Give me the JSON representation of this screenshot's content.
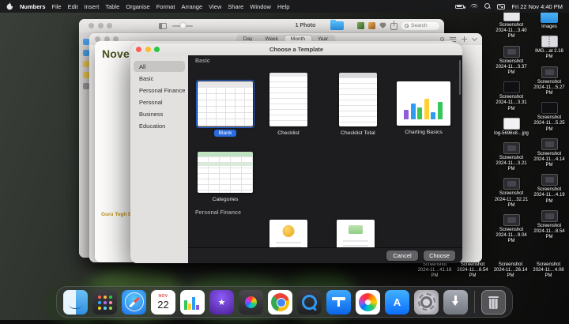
{
  "colors": {
    "accent": "#2a6bdf",
    "traffic_red": "#ff5f57",
    "traffic_yellow": "#febc2e",
    "traffic_green": "#28c840"
  },
  "menu_bar": {
    "app_name": "Numbers",
    "items": [
      "File",
      "Edit",
      "Insert",
      "Table",
      "Organise",
      "Format",
      "Arrange",
      "View",
      "Share",
      "Window",
      "Help"
    ],
    "clock": "Fri 22 Nov 4:40 PM"
  },
  "photos_window": {
    "count_label": "1 Photo",
    "search_placeholder": "Search"
  },
  "calendar_window": {
    "segments": [
      "Day",
      "Week",
      "Month",
      "Year"
    ],
    "selected_segment": "Month",
    "event_label": "Guru Tegh Baha…"
  },
  "numbers_window": {
    "doc_title": "Noven"
  },
  "template_chooser": {
    "title": "Choose a Template",
    "sidebar_items": [
      "All",
      "Basic",
      "Personal Finance",
      "Personal",
      "Business",
      "Education"
    ],
    "selected_category": "All",
    "section_basic": "Basic",
    "section_personal_finance": "Personal Finance",
    "templates": {
      "blank": "Blank",
      "checklist": "Checklist",
      "checklist_total": "Checklist Total",
      "charting_basics": "Charting Basics",
      "categories": "Categories"
    },
    "selected_template": "Blank",
    "buttons": {
      "cancel": "Cancel",
      "choose": "Choose"
    }
  },
  "desktop_icons": {
    "column1": [
      {
        "label": "Screenshot 2024-11…3.40 PM"
      },
      {
        "label": "Screenshot 2024-11…3.37 PM"
      },
      {
        "label": "Screenshot 2024-11…3.31 PM"
      },
      {
        "label": "log-5696x8…jpg"
      },
      {
        "label": "Screenshot 2024-11…3.21 PM"
      },
      {
        "label": "Screenshot 2024-11…32.21 PM"
      },
      {
        "label": "Screenshot 2024-11…9.04 PM"
      }
    ],
    "column2": [
      {
        "label": "Images"
      },
      {
        "label": "IMG…at 2.18 PM"
      },
      {
        "label": "Screenshot 2024-11…5.27 PM"
      },
      {
        "label": "Screenshot 2024-11…5.25 PM"
      },
      {
        "label": "Screenshot 2024-11…4.14 PM"
      },
      {
        "label": "Screenshot 2024-11…4.19 PM"
      },
      {
        "label": "Screenshot 2024-11…8.54 PM"
      }
    ],
    "bottom_row": [
      {
        "label": "Screenshot 2024-11…41.18 PM"
      },
      {
        "label": "Screenshot 2024-11…8.54 PM"
      },
      {
        "label": "Screenshot 2024-11…26.14 PM"
      },
      {
        "label": "Screenshot 2024-11…4.08 PM"
      }
    ]
  },
  "dock": {
    "apps": [
      "finder",
      "launchpad",
      "safari",
      "calendar",
      "numbers",
      "imovie",
      "photo-booth",
      "chrome",
      "quicktime",
      "keynote",
      "photos",
      "app-store",
      "system-settings",
      "downloads",
      "trash"
    ],
    "calendar_badge": {
      "month": "NOV",
      "day": "22"
    }
  },
  "icons": {
    "menu_bar": [
      "battery",
      "wifi",
      "spotlight",
      "control-center"
    ],
    "photos_toolbar": [
      "sidebar-toggle",
      "zoom-slider",
      "folder",
      "thumbnail",
      "favorite",
      "share",
      "search"
    ],
    "calendar_toolbar": [
      "search",
      "list",
      "add",
      "chevron-down"
    ]
  }
}
